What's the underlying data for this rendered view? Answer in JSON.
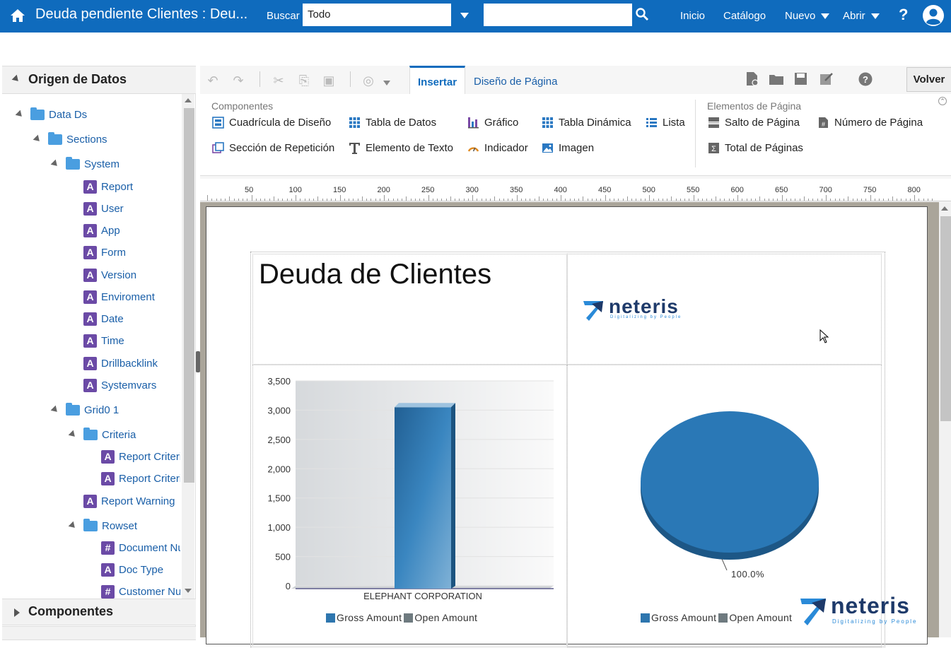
{
  "header": {
    "title": "Deuda pendiente Clientes : Deu...",
    "search_label": "Buscar",
    "search_scope": "Todo",
    "search_value": "",
    "nav": {
      "inicio": "Inicio",
      "catalogo": "Catálogo",
      "nuevo": "Nuevo",
      "abrir": "Abrir"
    },
    "help": "?"
  },
  "data_panel": {
    "title": "Origen de Datos",
    "tree": [
      {
        "label": "Data Ds",
        "type": "folder"
      },
      {
        "label": "Sections",
        "type": "folder"
      },
      {
        "label": "System",
        "type": "folder"
      },
      {
        "label": "Report",
        "type": "text"
      },
      {
        "label": "User",
        "type": "text"
      },
      {
        "label": "App",
        "type": "text"
      },
      {
        "label": "Form",
        "type": "text"
      },
      {
        "label": "Version",
        "type": "text"
      },
      {
        "label": "Enviroment",
        "type": "text"
      },
      {
        "label": "Date",
        "type": "text"
      },
      {
        "label": "Time",
        "type": "text"
      },
      {
        "label": "Drillbacklink",
        "type": "text"
      },
      {
        "label": "Systemvars",
        "type": "text"
      },
      {
        "label": "Grid0 1",
        "type": "folder"
      },
      {
        "label": "Criteria",
        "type": "folder"
      },
      {
        "label": "Report Criteri",
        "type": "text"
      },
      {
        "label": "Report Criteri",
        "type": "text"
      },
      {
        "label": "Report Warning",
        "type": "text"
      },
      {
        "label": "Rowset",
        "type": "folder"
      },
      {
        "label": "Document Nu",
        "type": "number"
      },
      {
        "label": "Doc Type",
        "type": "text"
      },
      {
        "label": "Customer Nu",
        "type": "number"
      }
    ],
    "type_badges": {
      "text": "A",
      "number": "#"
    }
  },
  "components_panel": {
    "title": "Componentes"
  },
  "tabs": {
    "insertar": "Insertar",
    "diseno": "Diseño de Página"
  },
  "volver": "Volver",
  "ribbon": {
    "componentes_label": "Componentes",
    "elementos_label": "Elementos de Página",
    "items": {
      "cuadricula": "Cuadrícula de Diseño",
      "tabla_datos": "Tabla de Datos",
      "grafico": "Gráfico",
      "tabla_dinamica": "Tabla Dinámica",
      "lista": "Lista",
      "seccion": "Sección de Repetición",
      "elemento_texto": "Elemento de Texto",
      "indicador": "Indicador",
      "imagen": "Imagen",
      "salto": "Salto de Página",
      "numero_pagina": "Número de Página",
      "total_paginas": "Total de Páginas"
    }
  },
  "ruler": {
    "marks": [
      "50",
      "100",
      "150",
      "200",
      "250",
      "300",
      "350",
      "400",
      "450",
      "500",
      "550",
      "600",
      "650",
      "700",
      "750",
      "800"
    ]
  },
  "report": {
    "title": "Deuda de Clientes",
    "logo_text": "neteris",
    "logo_tagline": "Digitalizing by People",
    "bar_category": "ELEPHANT CORPORATION",
    "pie_label": "100.0%",
    "legend": [
      "Gross Amount",
      "Open Amount"
    ]
  },
  "colors": {
    "brand": "#0f6bbd",
    "bar": "#2e76ae",
    "pie": "#2a78b6",
    "open": "#6e7a7f",
    "attr": "#6b4aa6",
    "folder": "#4a9ee0"
  },
  "chart_data": [
    {
      "type": "bar",
      "categories": [
        "ELEPHANT CORPORATION"
      ],
      "series": [
        {
          "name": "Gross Amount",
          "values": [
            3050
          ]
        },
        {
          "name": "Open Amount",
          "values": [
            0
          ]
        }
      ],
      "yticks": [
        "3,500",
        "3,000",
        "2,500",
        "2,000",
        "1,500",
        "1,000",
        "500",
        "0"
      ],
      "ylim": [
        0,
        3500
      ]
    },
    {
      "type": "pie",
      "labels": [
        "Gross Amount"
      ],
      "values": [
        100.0
      ],
      "slice_label": "100.0%"
    }
  ]
}
